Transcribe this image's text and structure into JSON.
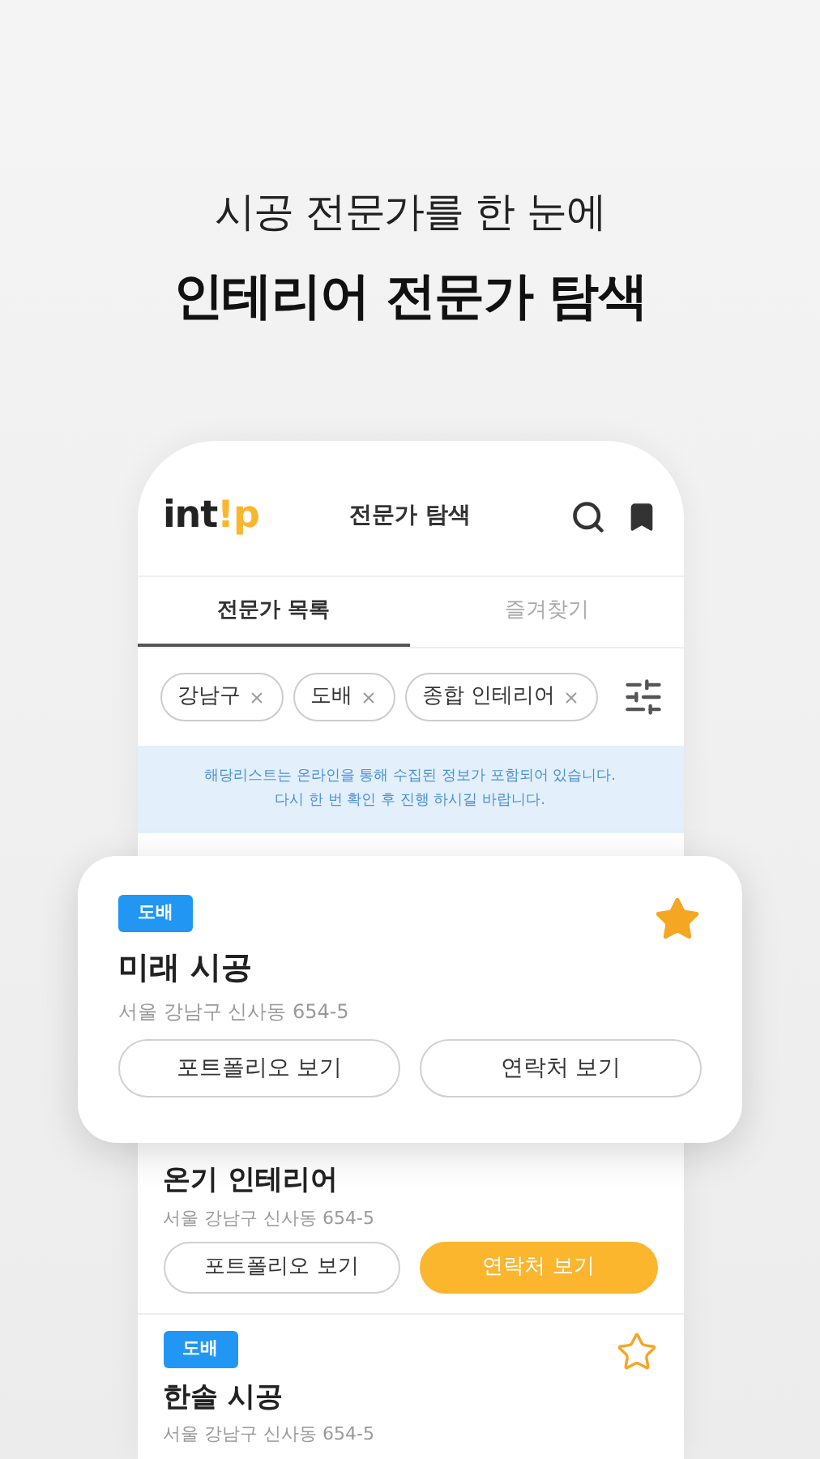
{
  "headline": {
    "subtitle": "시공 전문가를 한 눈에",
    "title": "인테리어 전문가 탐색"
  },
  "app": {
    "logo": {
      "plain": "int",
      "accent": "!p"
    },
    "title": "전문가 탐색",
    "tabs": [
      {
        "label": "전문가 목록",
        "selected": true
      },
      {
        "label": "즐겨찾기",
        "selected": false
      }
    ],
    "filters": [
      {
        "label": "강남구"
      },
      {
        "label": "도배"
      },
      {
        "label": "종합 인테리어"
      }
    ],
    "notice": [
      "해당리스트는 온라인을 통해 수집된 정보가 포함되어 있습니다.",
      "다시 한 번 확인 후 진행 하시길 바랍니다."
    ],
    "featured": {
      "tag": "도배",
      "name": "미래 시공",
      "address": "서울 강남구 신사동 654-5",
      "favorite": true,
      "portfolio_button": "포트폴리오 보기",
      "contact_button": "연락처 보기",
      "contact_highlighted": false
    },
    "items": [
      {
        "name": "온기 인테리어",
        "address": "서울 강남구 신사동 654-5",
        "portfolio_button": "포트폴리오 보기",
        "contact_button": "연락처 보기",
        "contact_highlighted": true
      },
      {
        "tag": "도배",
        "name": "한솔 시공",
        "address": "서울 강남구 신사동 654-5",
        "favorite": false
      }
    ]
  }
}
